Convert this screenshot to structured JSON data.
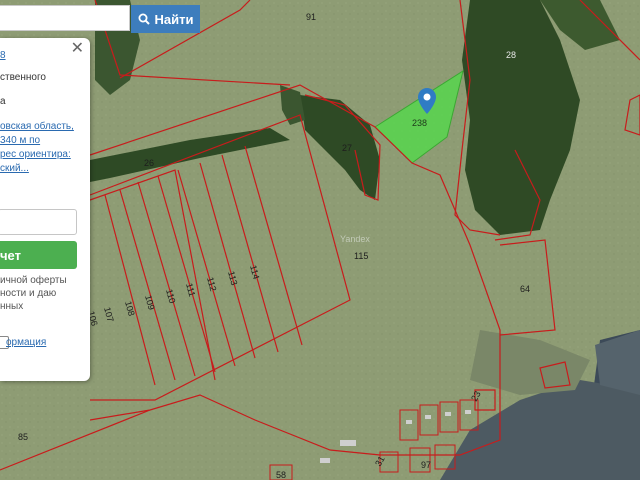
{
  "search": {
    "button_label": "Найти",
    "placeholder": ""
  },
  "map": {
    "watermark": "Yandex",
    "marker_label": "238",
    "parcel_labels": [
      "91",
      "28",
      "27",
      "26",
      "115",
      "64",
      "85",
      "114",
      "113",
      "112",
      "111",
      "110",
      "109",
      "108",
      "107",
      "106",
      "23",
      "31",
      "97",
      "58"
    ]
  },
  "panel": {
    "close_label": "✕",
    "lines": [
      "8",
      "ственного",
      "а",
      "овская область,",
      "340 м по",
      "рес ориентира:",
      "ский..."
    ],
    "button_label": "чет",
    "terms": [
      "ичной оферты",
      "ности и даю",
      "нных"
    ],
    "info_link": "ормация"
  },
  "colors": {
    "selected_parcel": "#57d64e",
    "parcel_border": "#c81c1c",
    "search_button": "#3d7dbd",
    "panel_button": "#4caf50"
  }
}
